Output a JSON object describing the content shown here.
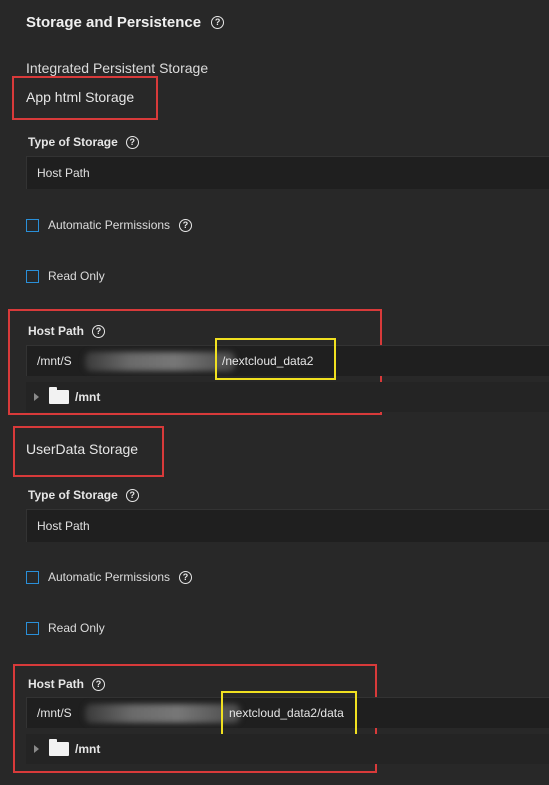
{
  "header": {
    "title": "Storage and Persistence",
    "help": "?"
  },
  "subtitle": "Integrated Persistent Storage",
  "groups": [
    {
      "title": "App html Storage",
      "type_label": "Type of Storage",
      "type_value": "Host Path",
      "auto_perm_label": "Automatic Permissions",
      "read_only_label": "Read Only",
      "host_path_label": "Host Path",
      "host_path_prefix": "/mnt/S",
      "host_path_suffix": "/nextcloud_data2",
      "tree_label": "/mnt"
    },
    {
      "title": "UserData Storage",
      "type_label": "Type of Storage",
      "type_value": "Host Path",
      "auto_perm_label": "Automatic Permissions",
      "read_only_label": "Read Only",
      "host_path_label": "Host Path",
      "host_path_prefix": "/mnt/S",
      "host_path_suffix": "nextcloud_data2/data",
      "tree_label": "/mnt"
    }
  ],
  "colors": {
    "background": "#282828",
    "checkbox_border": "#2a8fd8",
    "annotation_red": "#d83a3a",
    "annotation_yellow": "#f0e020"
  },
  "icons": {
    "help": "help-circle-icon",
    "folder": "folder-icon",
    "expand": "chevron-right-icon"
  }
}
